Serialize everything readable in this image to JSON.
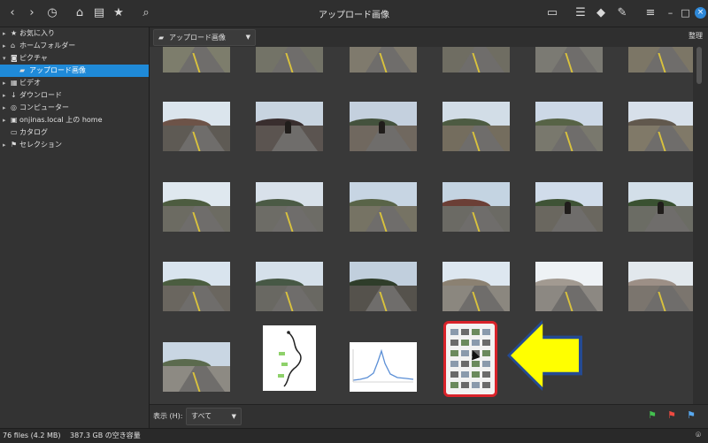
{
  "window": {
    "title": "アップロード画像"
  },
  "toolbar": {
    "back_icon": "chevron-left-icon",
    "forward_icon": "chevron-right-icon",
    "history_icon": "history-icon",
    "home_icon": "home-icon",
    "drive_icon": "drive-icon",
    "star_icon": "star-icon",
    "search_icon": "search-icon",
    "display_icon": "display-icon",
    "chat_icon": "chat-icon",
    "tag_icon": "tag-icon",
    "tools_icon": "wrench-icon",
    "menu_icon": "menu-icon",
    "min_icon": "minimize-icon",
    "max_icon": "maximize-icon",
    "close_icon": "close-icon"
  },
  "sidebar": {
    "items": [
      {
        "label": "お気に入り",
        "icon": "star-icon"
      },
      {
        "label": "ホームフォルダー",
        "icon": "home-icon"
      },
      {
        "label": "ピクチャ",
        "icon": "camera-icon"
      },
      {
        "label": "アップロード画像",
        "icon": "folder-icon"
      },
      {
        "label": "ビデオ",
        "icon": "video-icon"
      },
      {
        "label": "ダウンロード",
        "icon": "download-icon"
      },
      {
        "label": "コンピューター",
        "icon": "computer-icon"
      },
      {
        "label": "onjinas.local 上の home",
        "icon": "network-icon"
      },
      {
        "label": "カタログ",
        "icon": "catalog-icon"
      },
      {
        "label": "セレクション",
        "icon": "flag-icon"
      }
    ]
  },
  "topbar": {
    "folder_label": "アップロード画像",
    "folder_icon": "folder-icon",
    "sort_label": "整理"
  },
  "bottom": {
    "show_label": "表示 (H):",
    "show_value": "すべて",
    "flags": [
      "green-flag-icon",
      "red-flag-icon",
      "blue-flag-icon"
    ]
  },
  "status": {
    "left": "76 files (4.2 MB) 　387.3 GB の空き容量",
    "right_icon": "location-icon"
  },
  "colors": {
    "selection": "#1f8ad8",
    "highlight_border": "#d8232a",
    "arrow": "#ffff00"
  }
}
